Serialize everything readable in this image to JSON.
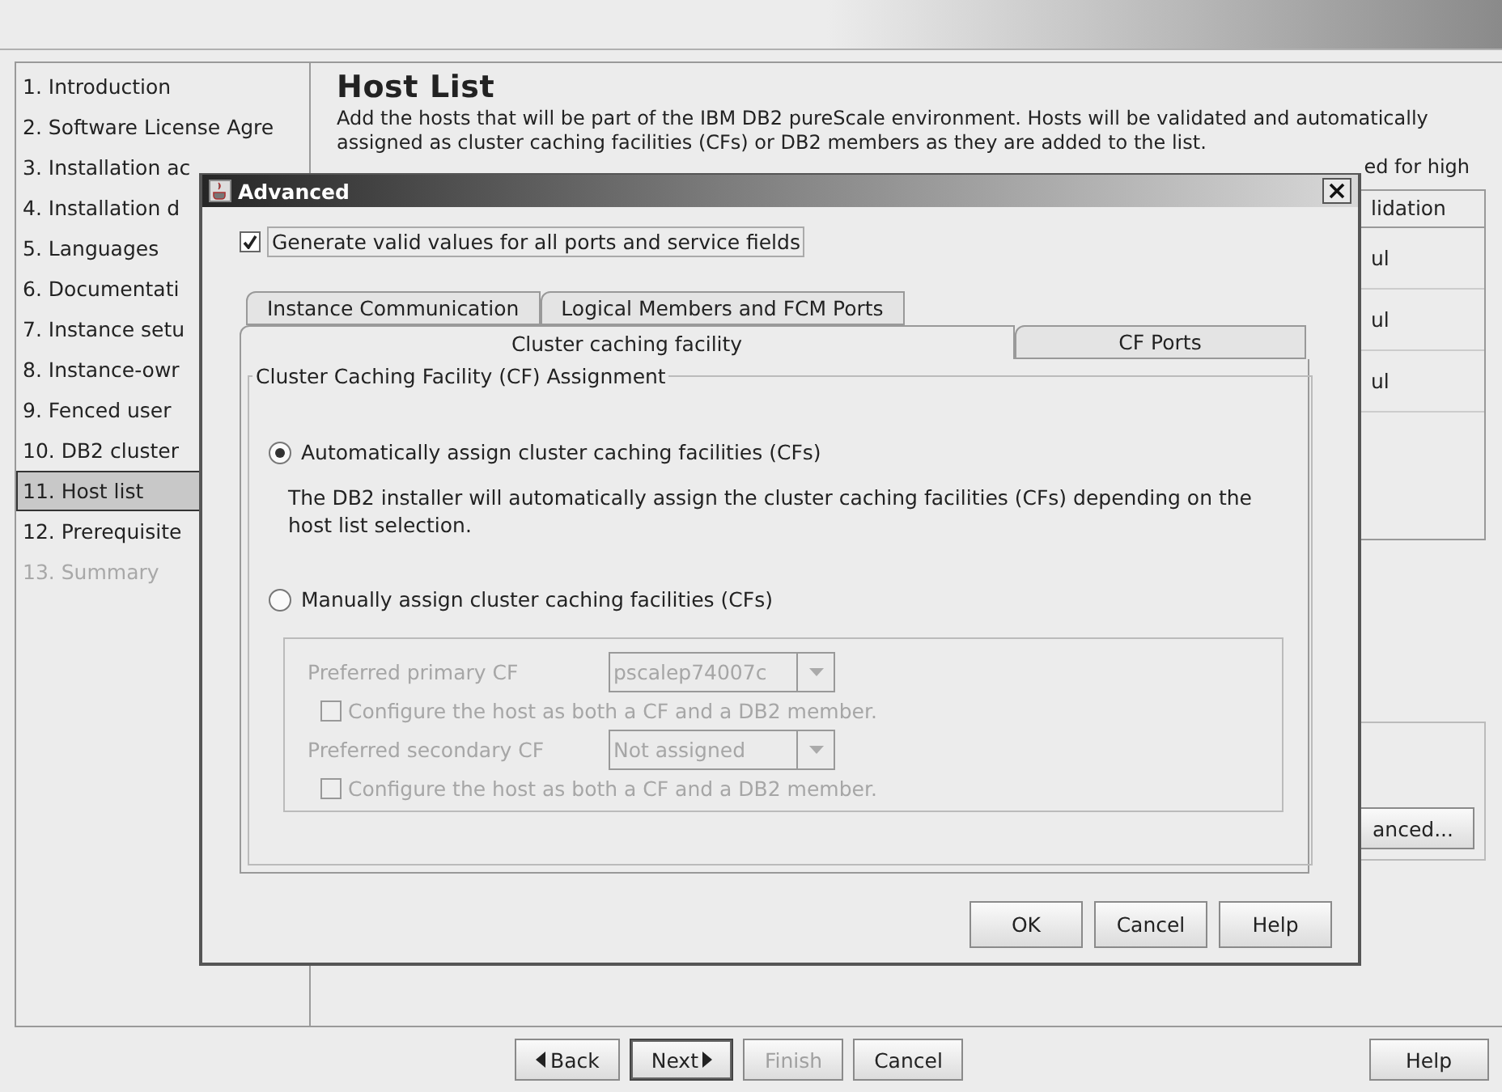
{
  "sidebar": {
    "items": [
      {
        "label": "1. Introduction",
        "selected": false,
        "disabled": false
      },
      {
        "label": "2. Software License Agre",
        "selected": false,
        "disabled": false
      },
      {
        "label": "3. Installation ac",
        "selected": false,
        "disabled": false
      },
      {
        "label": "4. Installation d",
        "selected": false,
        "disabled": false
      },
      {
        "label": "5. Languages",
        "selected": false,
        "disabled": false
      },
      {
        "label": "6. Documentati",
        "selected": false,
        "disabled": false
      },
      {
        "label": "7. Instance setu",
        "selected": false,
        "disabled": false
      },
      {
        "label": "8. Instance-owr",
        "selected": false,
        "disabled": false
      },
      {
        "label": "9. Fenced user",
        "selected": false,
        "disabled": false
      },
      {
        "label": "10. DB2 cluster",
        "selected": false,
        "disabled": false
      },
      {
        "label": "11. Host list",
        "selected": true,
        "disabled": false
      },
      {
        "label": "12. Prerequisite",
        "selected": false,
        "disabled": false
      },
      {
        "label": "13. Summary",
        "selected": false,
        "disabled": true
      }
    ]
  },
  "page": {
    "title": "Host List",
    "description": "Add the hosts that will be part of the IBM DB2 pureScale environment.  Hosts will be validated and automatically assigned as cluster caching facilities (CFs) or DB2 members as they are added to the list.",
    "description_fragment": "ed for high",
    "table": {
      "column": "lidation",
      "cells": [
        "ul",
        "ul",
        "ul"
      ]
    },
    "button": "anced..."
  },
  "dialog": {
    "title": "Advanced",
    "generate_checkbox": {
      "label": "Generate valid values for all ports and service fields",
      "checked": true
    },
    "tab_rows": [
      [
        {
          "label": "Instance Communication",
          "selected": false
        },
        {
          "label": "Logical Members and FCM Ports",
          "selected": false
        }
      ],
      [
        {
          "label": "Cluster caching facility",
          "selected": true
        },
        {
          "label": "CF Ports",
          "selected": false
        }
      ]
    ],
    "group_title": "Cluster Caching Facility (CF) Assignment",
    "auto_option": {
      "label": "Automatically assign cluster caching facilities (CFs)",
      "selected": true
    },
    "auto_description": "The DB2 installer will automatically assign the cluster caching facilities (CFs) depending on the host list selection.",
    "manual_option": {
      "label": "Manually assign cluster caching facilities (CFs)",
      "selected": false
    },
    "manual_settings": {
      "disabled": true,
      "rows": [
        {
          "label": "Preferred primary CF",
          "value": "pscalep74007c",
          "checkbox": {
            "label": "Configure the host as both a CF and a DB2 member.",
            "checked": false
          }
        },
        {
          "label": "Preferred secondary CF",
          "value": "Not assigned",
          "checkbox": {
            "label": "Configure the host as both a CF and a DB2 member.",
            "checked": false
          }
        }
      ]
    },
    "buttons": [
      "OK",
      "Cancel",
      "Help"
    ]
  },
  "footer": {
    "buttons": [
      {
        "label": "Back",
        "kind": "back",
        "disabled": false
      },
      {
        "label": "Next",
        "kind": "next",
        "disabled": false
      },
      {
        "label": "Finish",
        "kind": "plain",
        "disabled": true
      },
      {
        "label": "Cancel",
        "kind": "plain",
        "disabled": false
      }
    ],
    "help": "Help"
  }
}
